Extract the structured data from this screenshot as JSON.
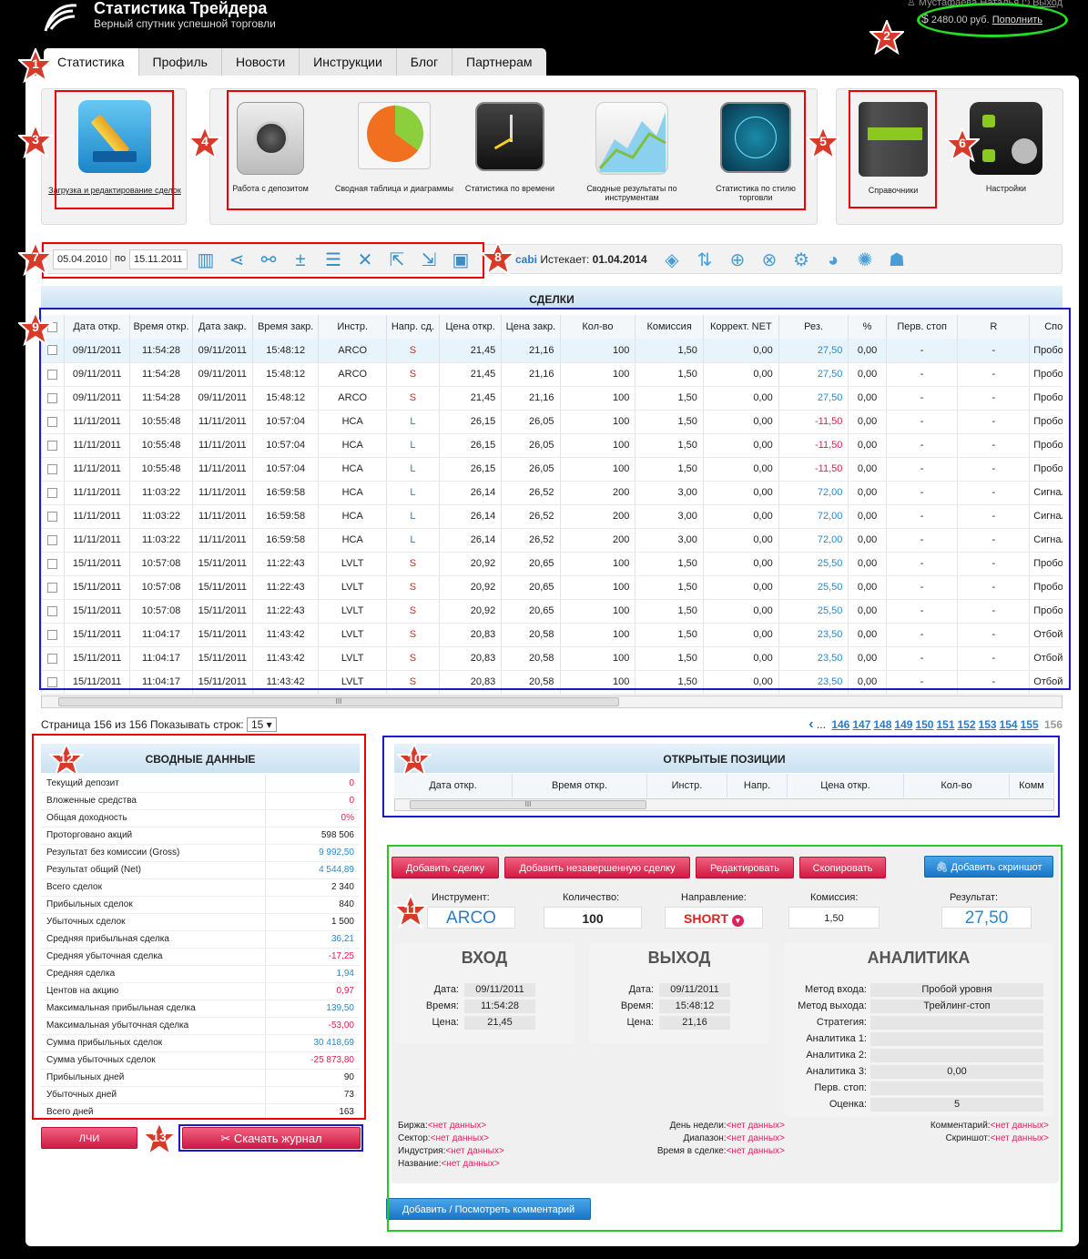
{
  "header": {
    "title": "Статистика Трейдера",
    "subtitle": "Верный спутник успешной торговли",
    "user": "Мустафаева Наталья",
    "logout": "Выход",
    "balance": "2480.00 руб.",
    "topup": "Пополнить"
  },
  "tabs": [
    "Статистика",
    "Профиль",
    "Новости",
    "Инструкции",
    "Блог",
    "Партнерам"
  ],
  "tiles": {
    "upload": "Загрузка и редактирование сделок",
    "deposit": "Работа с депозитом",
    "pivot": "Сводная таблица и диаграммы",
    "time": "Статистика по времени",
    "instr": "Сводные результаты по инструментам",
    "style": "Статистика по стилю торговли",
    "ref": "Справочники",
    "settings": "Настройки"
  },
  "toolbar": {
    "date_from": "05.04.2010",
    "to_label": "по",
    "date_to": "15.11.2011",
    "account": "cabi",
    "expires_label": "Истекает:",
    "expires": "01.04.2014"
  },
  "deals": {
    "title": "СДЕЛКИ",
    "columns": [
      "Дата откр.",
      "Время откр.",
      "Дата закр.",
      "Время закр.",
      "Инстр.",
      "Напр. сд.",
      "Цена откр.",
      "Цена закр.",
      "Кол-во",
      "Комиссия",
      "Коррект. NET",
      "Рез.",
      "%",
      "Перв. стоп",
      "R",
      "Спосо"
    ],
    "rows": [
      [
        "09/11/2011",
        "11:54:28",
        "09/11/2011",
        "15:48:12",
        "ARCO",
        "S",
        "21,45",
        "21,16",
        "100",
        "1,50",
        "0,00",
        "27,50",
        "0,00",
        "-",
        "-",
        "Пробой у"
      ],
      [
        "09/11/2011",
        "11:54:28",
        "09/11/2011",
        "15:48:12",
        "ARCO",
        "S",
        "21,45",
        "21,16",
        "100",
        "1,50",
        "0,00",
        "27,50",
        "0,00",
        "-",
        "-",
        "Пробой у"
      ],
      [
        "09/11/2011",
        "11:54:28",
        "09/11/2011",
        "15:48:12",
        "ARCO",
        "S",
        "21,45",
        "21,16",
        "100",
        "1,50",
        "0,00",
        "27,50",
        "0,00",
        "-",
        "-",
        "Пробой у"
      ],
      [
        "11/11/2011",
        "10:55:48",
        "11/11/2011",
        "10:57:04",
        "HCA",
        "L",
        "26,15",
        "26,05",
        "100",
        "1,50",
        "0,00",
        "-11,50",
        "0,00",
        "-",
        "-",
        "Пробой у"
      ],
      [
        "11/11/2011",
        "10:55:48",
        "11/11/2011",
        "10:57:04",
        "HCA",
        "L",
        "26,15",
        "26,05",
        "100",
        "1,50",
        "0,00",
        "-11,50",
        "0,00",
        "-",
        "-",
        "Пробой у"
      ],
      [
        "11/11/2011",
        "10:55:48",
        "11/11/2011",
        "10:57:04",
        "HCA",
        "L",
        "26,15",
        "26,05",
        "100",
        "1,50",
        "0,00",
        "-11,50",
        "0,00",
        "-",
        "-",
        "Пробой у"
      ],
      [
        "11/11/2011",
        "11:03:22",
        "11/11/2011",
        "16:59:58",
        "HCA",
        "L",
        "26,14",
        "26,52",
        "200",
        "3,00",
        "0,00",
        "72,00",
        "0,00",
        "-",
        "-",
        "Сигнал Т("
      ],
      [
        "11/11/2011",
        "11:03:22",
        "11/11/2011",
        "16:59:58",
        "HCA",
        "L",
        "26,14",
        "26,52",
        "200",
        "3,00",
        "0,00",
        "72,00",
        "0,00",
        "-",
        "-",
        "Сигнал Т("
      ],
      [
        "11/11/2011",
        "11:03:22",
        "11/11/2011",
        "16:59:58",
        "HCA",
        "L",
        "26,14",
        "26,52",
        "200",
        "3,00",
        "0,00",
        "72,00",
        "0,00",
        "-",
        "-",
        "Сигнал Т("
      ],
      [
        "15/11/2011",
        "10:57:08",
        "15/11/2011",
        "11:22:43",
        "LVLT",
        "S",
        "20,92",
        "20,65",
        "100",
        "1,50",
        "0,00",
        "25,50",
        "0,00",
        "-",
        "-",
        "Пробой у"
      ],
      [
        "15/11/2011",
        "10:57:08",
        "15/11/2011",
        "11:22:43",
        "LVLT",
        "S",
        "20,92",
        "20,65",
        "100",
        "1,50",
        "0,00",
        "25,50",
        "0,00",
        "-",
        "-",
        "Пробой у"
      ],
      [
        "15/11/2011",
        "10:57:08",
        "15/11/2011",
        "11:22:43",
        "LVLT",
        "S",
        "20,92",
        "20,65",
        "100",
        "1,50",
        "0,00",
        "25,50",
        "0,00",
        "-",
        "-",
        "Пробой у"
      ],
      [
        "15/11/2011",
        "11:04:17",
        "15/11/2011",
        "11:43:42",
        "LVLT",
        "S",
        "20,83",
        "20,58",
        "100",
        "1,50",
        "0,00",
        "23,50",
        "0,00",
        "-",
        "-",
        "Отбой от"
      ],
      [
        "15/11/2011",
        "11:04:17",
        "15/11/2011",
        "11:43:42",
        "LVLT",
        "S",
        "20,83",
        "20,58",
        "100",
        "1,50",
        "0,00",
        "23,50",
        "0,00",
        "-",
        "-",
        "Отбой от"
      ],
      [
        "15/11/2011",
        "11:04:17",
        "15/11/2011",
        "11:43:42",
        "LVLT",
        "S",
        "20,83",
        "20,58",
        "100",
        "1,50",
        "0,00",
        "23,50",
        "0,00",
        "-",
        "-",
        "Отбой от"
      ]
    ]
  },
  "pager": {
    "info": "Страница 156 из 156",
    "rows_label": "Показывать строк:",
    "rows": "15",
    "ellipsis": "...",
    "pages": [
      "146",
      "147",
      "148",
      "149",
      "150",
      "151",
      "152",
      "153",
      "154",
      "155"
    ],
    "current": "156"
  },
  "summary": {
    "title": "СВОДНЫЕ ДАННЫЕ",
    "rows": [
      [
        "Текущий депозит",
        "0",
        "neg"
      ],
      [
        "Вложенные средства",
        "0",
        "neg"
      ],
      [
        "Общая доходность",
        "0%",
        "neg"
      ],
      [
        "Проторговано акций",
        "598 506",
        ""
      ],
      [
        "Результат без комиссии (Gross)",
        "9 992,50",
        "pos"
      ],
      [
        "Результат общий (Net)",
        "4 544,89",
        "pos"
      ],
      [
        "Всего сделок",
        "2 340",
        ""
      ],
      [
        "Прибыльных сделок",
        "840",
        ""
      ],
      [
        "Убыточных сделок",
        "1 500",
        ""
      ],
      [
        "Средняя прибыльная сделка",
        "36,21",
        "pos"
      ],
      [
        "Средняя убыточная сделка",
        "-17,25",
        "neg"
      ],
      [
        "Средняя сделка",
        "1,94",
        "pos"
      ],
      [
        "Центов на акцию",
        "0,97",
        "neg"
      ],
      [
        "Максимальная прибыльная сделка",
        "139,50",
        "pos"
      ],
      [
        "Максимальная убыточная сделка",
        "-53,00",
        "neg"
      ],
      [
        "Сумма прибыльных сделок",
        "30 418,69",
        "pos"
      ],
      [
        "Сумма убыточных сделок",
        "-25 873,80",
        "neg"
      ],
      [
        "Прибыльных дней",
        "90",
        ""
      ],
      [
        "Убыточных дней",
        "73",
        ""
      ],
      [
        "Всего дней",
        "163",
        ""
      ]
    ]
  },
  "open_positions": {
    "title": "ОТКРЫТЫЕ ПОЗИЦИИ",
    "columns": [
      "Дата откр.",
      "Время откр.",
      "Инстр.",
      "Напр.",
      "Цена откр.",
      "Кол-во",
      "Комм"
    ]
  },
  "bottom_buttons": {
    "lchi": "ЛЧИ",
    "download": "Скачать журнал"
  },
  "detail": {
    "buttons": {
      "add": "Добавить сделку",
      "add_open": "Добавить незавершенную сделку",
      "edit": "Редактировать",
      "copy": "Скопировать",
      "screenshot": "Добавить скриншот"
    },
    "labels": {
      "instrument": "Инструмент:",
      "quantity": "Количество:",
      "direction": "Направление:",
      "commission": "Комиссия:",
      "result": "Результат:"
    },
    "values": {
      "instrument": "ARCO",
      "quantity": "100",
      "direction": "SHORT",
      "commission": "1,50",
      "result": "27,50"
    },
    "entry": {
      "title": "ВХОД",
      "date_l": "Дата:",
      "date": "09/11/2011",
      "time_l": "Время:",
      "time": "11:54:28",
      "price_l": "Цена:",
      "price": "21,45"
    },
    "exit": {
      "title": "ВЫХОД",
      "date_l": "Дата:",
      "date": "09/11/2011",
      "time_l": "Время:",
      "time": "15:48:12",
      "price_l": "Цена:",
      "price": "21,16"
    },
    "analytics": {
      "title": "АНАЛИТИКА",
      "rows": [
        [
          "Метод входа:",
          "Пробой уровня"
        ],
        [
          "Метод выхода:",
          "Трейлинг-стоп"
        ],
        [
          "Стратегия:",
          ""
        ],
        [
          "Аналитика 1:",
          ""
        ],
        [
          "Аналитика 2:",
          ""
        ],
        [
          "Аналитика 3:",
          "0,00"
        ],
        [
          "Перв. стоп:",
          ""
        ],
        [
          "Оценка:",
          "5"
        ]
      ]
    },
    "info_left": [
      [
        "Биржа:",
        "<нет данных>"
      ],
      [
        "Сектор:",
        "<нет данных>"
      ],
      [
        "Индустрия:",
        "<нет данных>"
      ],
      [
        "Название:",
        "<нет данных>"
      ]
    ],
    "info_mid": [
      [
        "День недели:",
        "<нет данных>"
      ],
      [
        "Диапазон:",
        "<нет данных>"
      ],
      [
        "Время в сделке:",
        "<нет данных>"
      ]
    ],
    "info_right": [
      [
        "Комментарий:",
        "<нет данных>"
      ],
      [
        "Скриншот:",
        "<нет данных>"
      ]
    ],
    "comments_btn": "Добавить / Посмотреть комментарий"
  },
  "markers": [
    "1",
    "2",
    "3",
    "4",
    "5",
    "6",
    "7",
    "8",
    "9",
    "10",
    "11",
    "12",
    "13"
  ],
  "colors": {
    "accent_red": "#d01a44",
    "accent_blue": "#1a76c8",
    "positive": "#2a88cc",
    "negative": "#e0204a"
  }
}
